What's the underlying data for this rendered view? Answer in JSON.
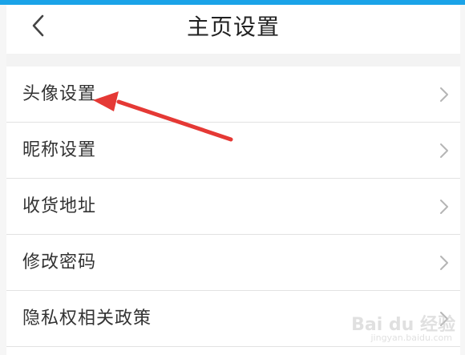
{
  "header": {
    "title": "主页设置",
    "back_icon": "chevron-left-icon"
  },
  "menu": {
    "items": [
      {
        "label": "头像设置"
      },
      {
        "label": "昵称设置"
      },
      {
        "label": "收货地址"
      },
      {
        "label": "修改密码"
      },
      {
        "label": "隐私权相关政策"
      }
    ],
    "chevron_icon": "chevron-right-icon"
  },
  "annotation": {
    "color": "#e53935",
    "points_to": "头像设置"
  },
  "watermark": {
    "main": "Bai du 经验",
    "sub": "jingyan.baidu.com"
  },
  "colors": {
    "top_bar": "#1aa3e8",
    "background": "#f3f3f3",
    "text": "#333333",
    "divider": "#e2e2e2"
  }
}
